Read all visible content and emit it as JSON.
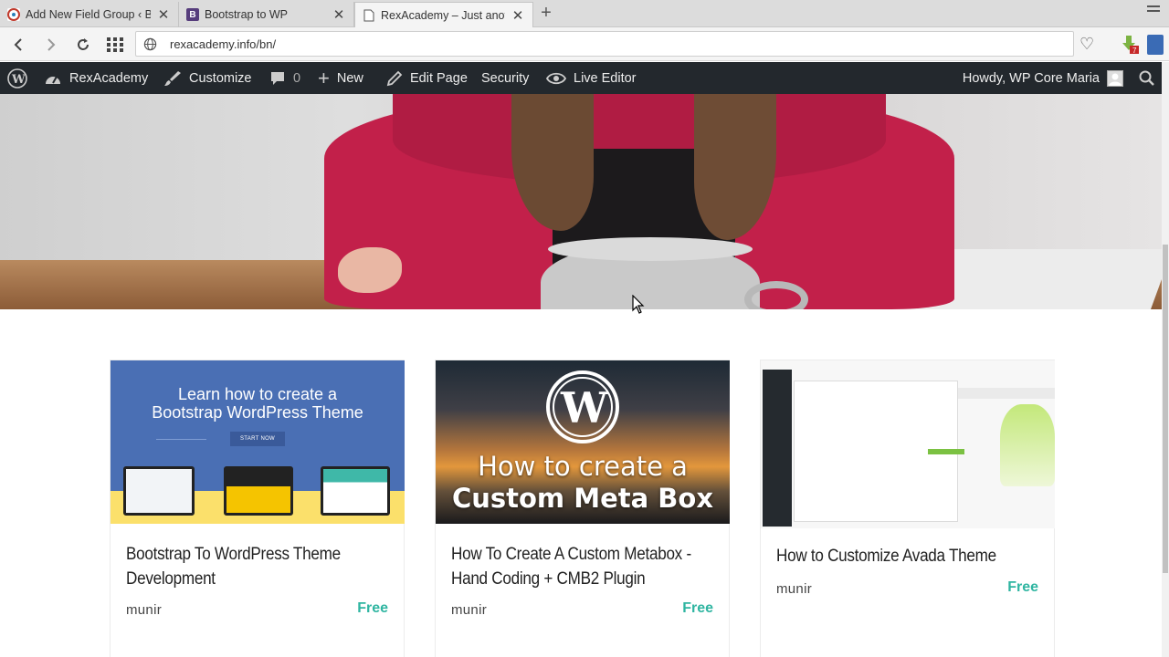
{
  "browser": {
    "tabs": [
      {
        "title": "Add New Field Group ‹ Bo",
        "active": false,
        "favicon": "acf-icon"
      },
      {
        "title": "Bootstrap to WP",
        "active": false,
        "favicon": "bootstrap-icon"
      },
      {
        "title": "RexAcademy – Just anothe",
        "active": true,
        "favicon": "wp-page-icon"
      }
    ],
    "url": "rexacademy.info/bn/"
  },
  "adminbar": {
    "site_name": "RexAcademy",
    "customize": "Customize",
    "comments_count": "0",
    "new": "New",
    "edit_page": "Edit Page",
    "security": "Security",
    "live_editor": "Live Editor",
    "howdy": "Howdy, WP Core Maria"
  },
  "cards": [
    {
      "image_text_lines": [
        "Learn how to create a",
        "Bootstrap WordPress Theme"
      ],
      "image_button": "START NOW",
      "title_lines": [
        "Bootstrap To WordPress Theme",
        "Development"
      ],
      "author": "munir",
      "price": "Free"
    },
    {
      "image_text_lines": [
        "How to create a",
        "Custom Meta Box"
      ],
      "title_lines": [
        "How To Create A Custom Metabox -",
        "Hand Coding + CMB2 Plugin"
      ],
      "author": "munir",
      "price": "Free"
    },
    {
      "title_lines": [
        "How to Customize Avada Theme"
      ],
      "author": "munir",
      "price": "Free"
    }
  ],
  "colors": {
    "adminbar_bg": "#23282d",
    "price_accent": "#2fb5a1"
  }
}
